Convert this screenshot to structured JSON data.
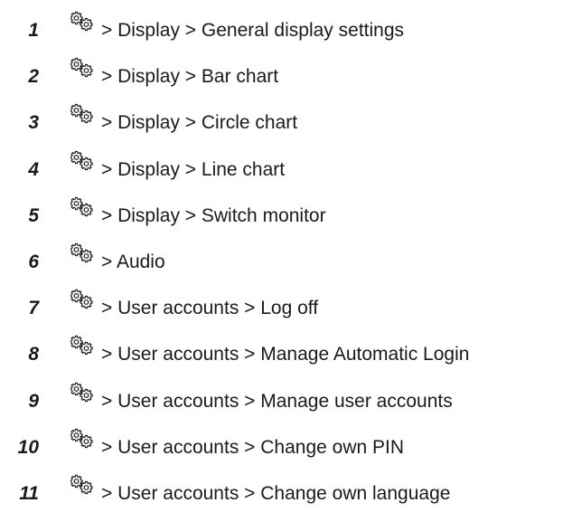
{
  "items": [
    {
      "number": "1",
      "icon": "gears-icon",
      "path": "> Display > General display settings"
    },
    {
      "number": "2",
      "icon": "gears-icon",
      "path": "> Display > Bar chart"
    },
    {
      "number": "3",
      "icon": "gears-icon",
      "path": "> Display > Circle chart"
    },
    {
      "number": "4",
      "icon": "gears-icon",
      "path": "> Display > Line chart"
    },
    {
      "number": "5",
      "icon": "gears-icon",
      "path": "> Display > Switch monitor"
    },
    {
      "number": "6",
      "icon": "gears-icon",
      "path": "> Audio"
    },
    {
      "number": "7",
      "icon": "gears-icon",
      "path": "> User accounts > Log off"
    },
    {
      "number": "8",
      "icon": "gears-icon",
      "path": "> User accounts > Manage Automatic Login"
    },
    {
      "number": "9",
      "icon": "gears-icon",
      "path": "> User accounts > Manage user accounts"
    },
    {
      "number": "10",
      "icon": "gears-icon",
      "path": "> User accounts > Change own PIN"
    },
    {
      "number": "11",
      "icon": "gears-icon",
      "path": "> User accounts > Change own language"
    }
  ]
}
